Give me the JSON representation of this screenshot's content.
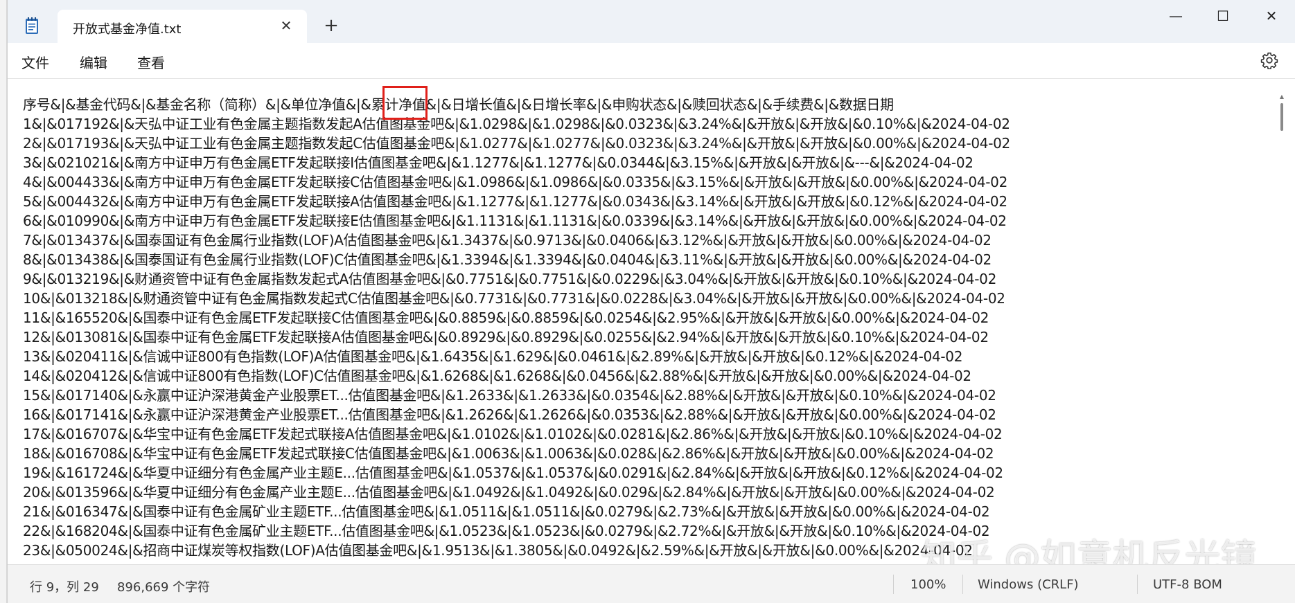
{
  "window": {
    "tab_title": "开放式基金净值.txt",
    "tab_close_glyph": "✕",
    "new_tab_glyph": "+",
    "minimize_glyph": "—",
    "maximize_glyph": "☐",
    "close_glyph": "✕"
  },
  "menu": {
    "file": "文件",
    "edit": "编辑",
    "view": "查看"
  },
  "icons": {
    "app": "notepad-icon",
    "settings": "gear-icon"
  },
  "editor": {
    "lines": [
      "序号&|&基金代码&|&基金名称（简称）&|&单位净值&|&累计净值&|&日增长值&|&日增长率&|&申购状态&|&赎回状态&|&手续费&|&数据日期",
      "1&|&017192&|&天弘中证工业有色金属主题指数发起A估值图基金吧&|&1.0298&|&1.0298&|&0.0323&|&3.24%&|&开放&|&开放&|&0.10%&|&2024-04-02",
      "2&|&017193&|&天弘中证工业有色金属主题指数发起C估值图基金吧&|&1.0277&|&1.0277&|&0.0323&|&3.24%&|&开放&|&开放&|&0.00%&|&2024-04-02",
      "3&|&021021&|&南方中证申万有色金属ETF发起联接I估值图基金吧&|&1.1277&|&1.1277&|&0.0344&|&3.15%&|&开放&|&开放&|&---&|&2024-04-02",
      "4&|&004433&|&南方中证申万有色金属ETF发起联接C估值图基金吧&|&1.0986&|&1.0986&|&0.0335&|&3.15%&|&开放&|&开放&|&0.00%&|&2024-04-02",
      "5&|&004432&|&南方中证申万有色金属ETF发起联接A估值图基金吧&|&1.1277&|&1.1277&|&0.0343&|&3.14%&|&开放&|&开放&|&0.12%&|&2024-04-02",
      "6&|&010990&|&南方中证申万有色金属ETF发起联接E估值图基金吧&|&1.1131&|&1.1131&|&0.0339&|&3.14%&|&开放&|&开放&|&0.00%&|&2024-04-02",
      "7&|&013437&|&国泰国证有色金属行业指数(LOF)A估值图基金吧&|&1.3437&|&0.9713&|&0.0406&|&3.12%&|&开放&|&开放&|&0.00%&|&2024-04-02",
      "8&|&013438&|&国泰国证有色金属行业指数(LOF)C估值图基金吧&|&1.3394&|&1.3394&|&0.0404&|&3.11%&|&开放&|&开放&|&0.00%&|&2024-04-02",
      "9&|&013219&|&财通资管中证有色金属指数发起式A估值图基金吧&|&0.7751&|&0.7751&|&0.0229&|&3.04%&|&开放&|&开放&|&0.10%&|&2024-04-02",
      "10&|&013218&|&财通资管中证有色金属指数发起式C估值图基金吧&|&0.7731&|&0.7731&|&0.0228&|&3.04%&|&开放&|&开放&|&0.00%&|&2024-04-02",
      "11&|&165520&|&国泰中证有色金属ETF发起联接C估值图基金吧&|&0.8859&|&0.8859&|&0.0254&|&2.95%&|&开放&|&开放&|&0.00%&|&2024-04-02",
      "12&|&013081&|&国泰中证有色金属ETF发起联接A估值图基金吧&|&0.8929&|&0.8929&|&0.0255&|&2.94%&|&开放&|&开放&|&0.10%&|&2024-04-02",
      "13&|&020411&|&信诚中证800有色指数(LOF)A估值图基金吧&|&1.6435&|&1.629&|&0.0461&|&2.89%&|&开放&|&开放&|&0.12%&|&2024-04-02",
      "14&|&020412&|&信诚中证800有色指数(LOF)C估值图基金吧&|&1.6268&|&1.6268&|&0.0456&|&2.88%&|&开放&|&开放&|&0.00%&|&2024-04-02",
      "15&|&017140&|&永赢中证沪深港黄金产业股票ET...估值图基金吧&|&1.2633&|&1.2633&|&0.0354&|&2.88%&|&开放&|&开放&|&0.10%&|&2024-04-02",
      "16&|&017141&|&永赢中证沪深港黄金产业股票ET...估值图基金吧&|&1.2626&|&1.2626&|&0.0353&|&2.88%&|&开放&|&开放&|&0.00%&|&2024-04-02",
      "17&|&016707&|&华宝中证有色金属ETF发起式联接A估值图基金吧&|&1.0102&|&1.0102&|&0.0281&|&2.86%&|&开放&|&开放&|&0.10%&|&2024-04-02",
      "18&|&016708&|&华宝中证有色金属ETF发起式联接C估值图基金吧&|&1.0063&|&1.0063&|&0.028&|&2.86%&|&开放&|&开放&|&0.00%&|&2024-04-02",
      "19&|&161724&|&华夏中证细分有色金属产业主题E...估值图基金吧&|&1.0537&|&1.0537&|&0.0291&|&2.84%&|&开放&|&开放&|&0.12%&|&2024-04-02",
      "20&|&013596&|&华夏中证细分有色金属产业主题E...估值图基金吧&|&1.0492&|&1.0492&|&0.029&|&2.84%&|&开放&|&开放&|&0.00%&|&2024-04-02",
      "21&|&016347&|&国泰中证有色金属矿业主题ETF...估值图基金吧&|&1.0511&|&1.0511&|&0.0279&|&2.73%&|&开放&|&开放&|&0.00%&|&2024-04-02",
      "22&|&168204&|&国泰中证有色金属矿业主题ETF...估值图基金吧&|&1.0523&|&1.0523&|&0.0279&|&2.72%&|&开放&|&开放&|&0.10%&|&2024-04-02",
      "23&|&050024&|&招商中证煤炭等权指数(LOF)A估值图基金吧&|&1.9513&|&1.3805&|&0.0492&|&2.59%&|&开放&|&开放&|&0.00%&|&2024-04-02"
    ]
  },
  "watermark": "知乎 @如意机反光镜",
  "status": {
    "position": "行 9，列 29",
    "char_count": "896,669 个字符",
    "zoom": "100%",
    "line_ending": "Windows (CRLF)",
    "encoding": "UTF-8 BOM"
  }
}
